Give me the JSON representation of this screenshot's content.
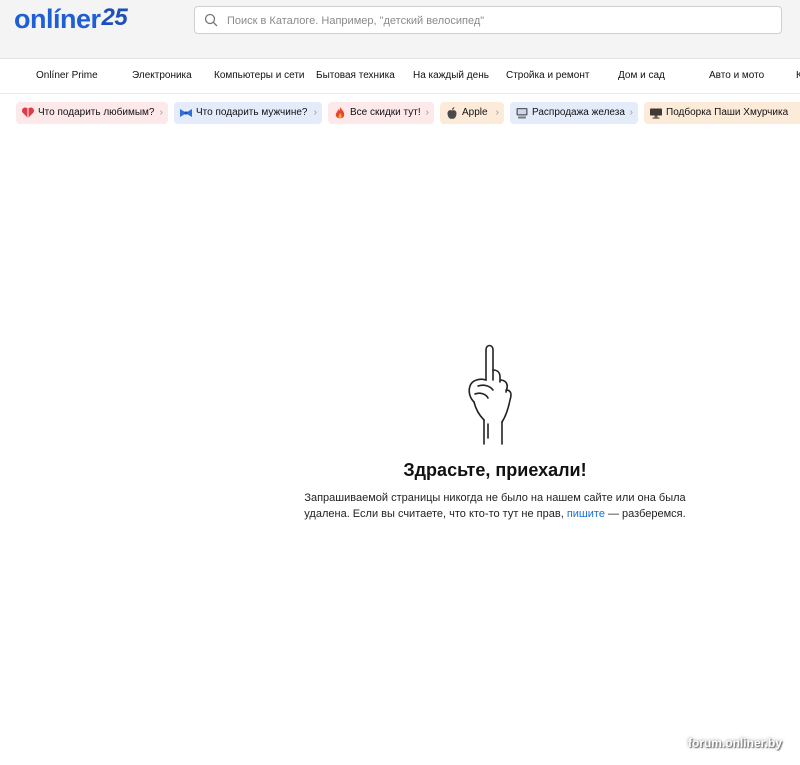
{
  "header": {
    "logo_text": "onlíner",
    "logo_number": "25",
    "search_placeholder": "Поиск в Каталоге. Например, \"детский велосипед\""
  },
  "nav": {
    "items": [
      "Onlíner Prime",
      "Электроника",
      "Компьютеры и сети",
      "Бытовая техника",
      "На каждый день",
      "Стройка и ремонт",
      "Дом и сад",
      "Авто и мото",
      "К"
    ]
  },
  "chips": [
    {
      "label": "Что подарить любимым?",
      "icon": "heart-gift-icon",
      "bg": "#fde8ea"
    },
    {
      "label": "Что подарить мужчине?",
      "icon": "bow-tie-icon",
      "bg": "#e4ebfa"
    },
    {
      "label": "Все скидки тут!",
      "icon": "fire-icon",
      "bg": "#fde8ea"
    },
    {
      "label": "Apple",
      "icon": "apple-icon",
      "bg": "#fdebd9"
    },
    {
      "label": "Распродажа железа",
      "icon": "computer-icon",
      "bg": "#e4ebfa"
    },
    {
      "label": "Подборка Паши Хмурчика",
      "icon": "monitor-icon",
      "bg": "#fdebd9"
    }
  ],
  "error": {
    "title": "Здрасьте, приехали!",
    "message_before": "Запрашиваемой страницы никогда не было на нашем сайте или она была удалена. Если вы считаете, что кто-то тут не прав, ",
    "link_text": "пишите",
    "message_after": " — разберемся."
  },
  "watermark": "forum.onliner.by",
  "colors": {
    "brand": "#1f5fd6",
    "link": "#1a6fd8",
    "header_bg": "#f4f4f5"
  }
}
